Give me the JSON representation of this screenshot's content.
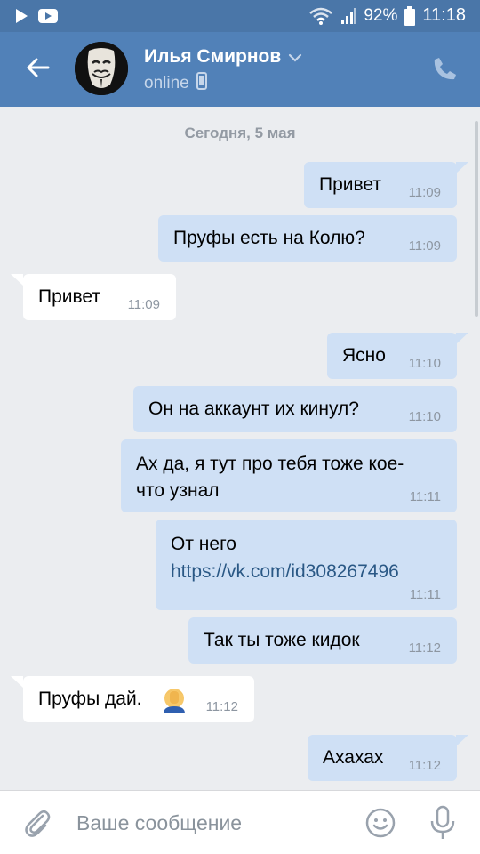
{
  "status_bar": {
    "battery": "92%",
    "time": "11:18",
    "icons": [
      "play-icon",
      "youtube-icon",
      "wifi-icon",
      "signal-icon",
      "battery-icon"
    ]
  },
  "header": {
    "contact_name": "Илья Смирнов",
    "status": "online",
    "icons": [
      "back-arrow-icon",
      "avatar",
      "chevron-down-icon",
      "phone-icon",
      "call-icon"
    ]
  },
  "chat": {
    "date_separator": "Сегодня, 5 мая",
    "messages": [
      {
        "dir": "out",
        "text": "Привет",
        "time": "11:09"
      },
      {
        "dir": "out",
        "text": "Пруфы есть на Колю?",
        "time": "11:09"
      },
      {
        "dir": "in",
        "text": "Привет",
        "time": "11:09"
      },
      {
        "dir": "out",
        "text": "Ясно",
        "time": "11:10"
      },
      {
        "dir": "out",
        "text": "Он на аккаунт их кинул?",
        "time": "11:10"
      },
      {
        "dir": "out",
        "text_line1": "Ах да, я тут про тебя тоже кое-",
        "text_line2": "что узнал",
        "time": "11:11"
      },
      {
        "dir": "out",
        "text_line1": "От него",
        "link": "https://vk.com/id308267496",
        "time": "11:11"
      },
      {
        "dir": "out",
        "text": "Так ты тоже кидок",
        "time": "11:12"
      },
      {
        "dir": "in",
        "text": "Пруфы дай.",
        "emoji": "facepalm-emoji",
        "time": "11:12"
      },
      {
        "dir": "out",
        "text": "Ахахах",
        "time": "11:12"
      }
    ]
  },
  "composer": {
    "placeholder": "Ваше сообщение",
    "icons": [
      "paperclip-icon",
      "emoji-icon",
      "microphone-icon"
    ]
  },
  "colors": {
    "header_bg": "#5181b8",
    "statusbar_bg": "#4a76a8",
    "chat_bg": "#ebedf0",
    "outgoing_bubble": "#cfe0f5",
    "incoming_bubble": "#ffffff",
    "link": "#2a5885"
  }
}
